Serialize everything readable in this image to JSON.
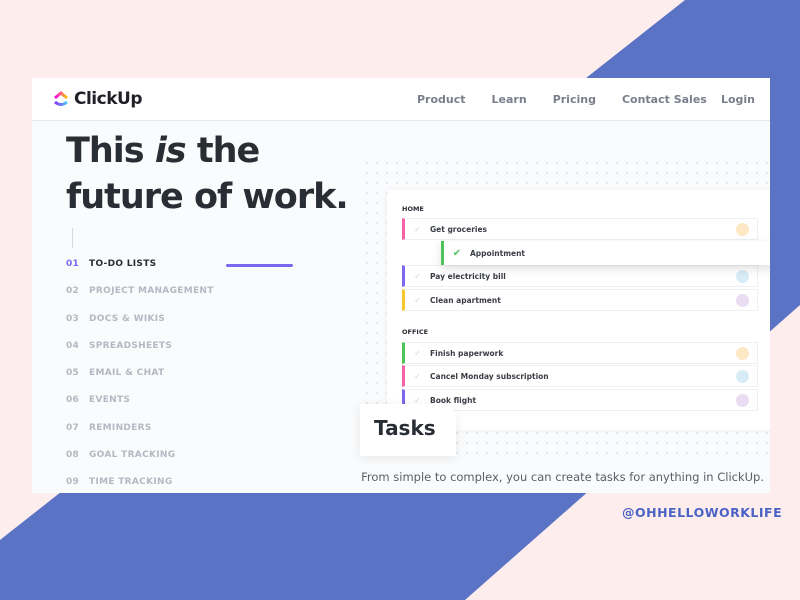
{
  "colors": {
    "background": "#fdeeed",
    "stripe": "#5b73c4",
    "accent": "#7b68ee"
  },
  "header": {
    "brand": "ClickUp",
    "nav": [
      "Product",
      "Learn",
      "Pricing",
      "Contact Sales"
    ],
    "login": "Login"
  },
  "hero": {
    "line1_a": "This ",
    "line1_em": "is",
    "line1_b": " the",
    "line2": "future of work."
  },
  "menu": [
    {
      "num": "01",
      "label": "TO-DO LISTS",
      "active": true
    },
    {
      "num": "02",
      "label": "PROJECT MANAGEMENT"
    },
    {
      "num": "03",
      "label": "DOCS & WIKIS"
    },
    {
      "num": "04",
      "label": "SPREADSHEETS"
    },
    {
      "num": "05",
      "label": "EMAIL & CHAT"
    },
    {
      "num": "06",
      "label": "EVENTS"
    },
    {
      "num": "07",
      "label": "REMINDERS"
    },
    {
      "num": "08",
      "label": "GOAL TRACKING"
    },
    {
      "num": "09",
      "label": "TIME TRACKING"
    }
  ],
  "tasks": {
    "home_label": "HOME",
    "office_label": "OFFICE",
    "home": [
      {
        "name": "Get groceries",
        "color": "#f562a6"
      },
      {
        "name": "Pay electricity bill",
        "color": "#7b68ee"
      },
      {
        "name": "Clean apartment",
        "color": "#f8c72c"
      }
    ],
    "dragged": "Appointment",
    "office": [
      {
        "name": "Finish paperwork",
        "color": "#4fc35a"
      },
      {
        "name": "Cancel Monday subscription",
        "color": "#f562a6"
      },
      {
        "name": "Book flight",
        "color": "#7b68ee"
      }
    ]
  },
  "feature_title": "Tasks",
  "caption": "From simple to complex, you can create tasks for anything in ClickUp.",
  "handle": "@OHHELLOWORKLIFE"
}
